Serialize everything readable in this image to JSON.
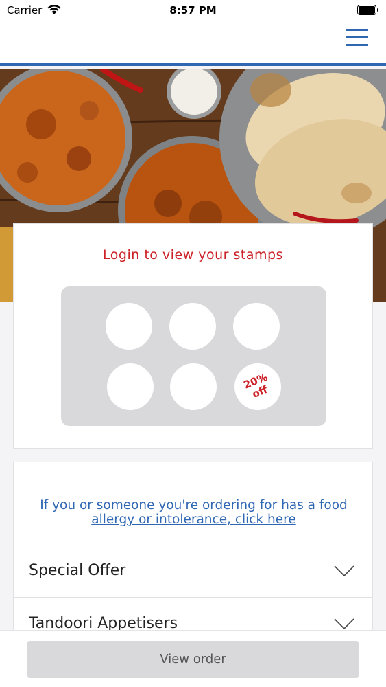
{
  "status_bar": {
    "carrier": "Carrier",
    "time": "8:57 PM"
  },
  "header": {
    "menu_icon": "hamburger-menu-icon",
    "accent_color": "#2f67b3"
  },
  "stamp_card": {
    "title": "Login to view your stamps",
    "title_color": "#cc2127",
    "reward_text": "20% off"
  },
  "allergy": {
    "link_text": "If you or someone you're ordering for has a food allergy or intolerance, click here"
  },
  "menu_categories": [
    {
      "label": "Special Offer"
    },
    {
      "label": "Tandoori Appetisers"
    }
  ],
  "footer": {
    "view_order_label": "View order"
  }
}
